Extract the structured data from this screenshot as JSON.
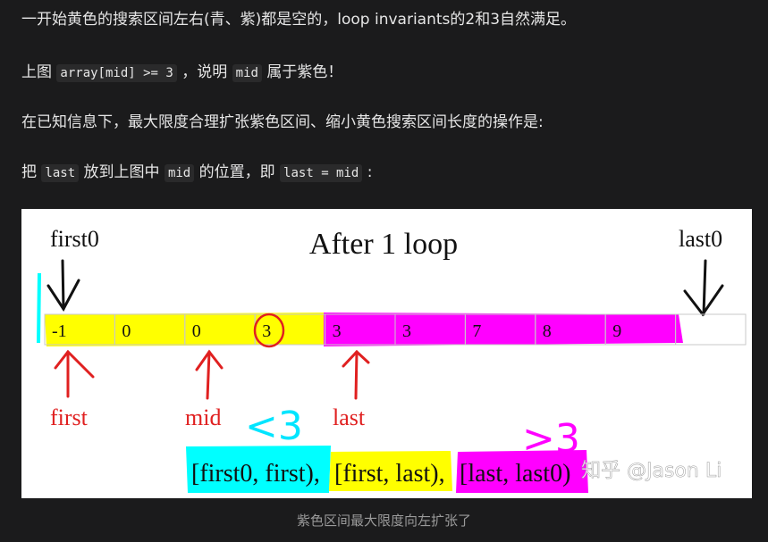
{
  "paragraphs": {
    "p1": "一开始黄色的搜索区间左右(青、紫)都是空的，loop invariants的2和3自然满足。",
    "p2_prefix": "上图",
    "p2_code1": "array[mid] >= 3",
    "p2_mid": "，说明",
    "p2_code2": "mid",
    "p2_suffix": "属于紫色！",
    "p3": "在已知信息下，最大限度合理扩张紫色区间、缩小黄色搜索区间长度的操作是:",
    "p4_prefix": "把",
    "p4_code1": "last",
    "p4_mid1": "放到上图中",
    "p4_code2": "mid",
    "p4_mid2": "的位置，即",
    "p4_code3": "last = mid",
    "p4_suffix": ":"
  },
  "figure": {
    "title": "After 1 loop",
    "label_first0": "first0",
    "label_last0": "last0",
    "cells": [
      "-1",
      "0",
      "0",
      "3",
      "3",
      "3",
      "7",
      "8",
      "9",
      ""
    ],
    "label_first": "first",
    "label_mid": "mid",
    "label_last": "last",
    "note_lt3": "<3",
    "note_ge3": ">3",
    "interval_cyan": "[first0, first),",
    "interval_yellow": "[first, last),",
    "interval_magenta": "[last, last0)",
    "watermark": "知乎 @Jason Li",
    "colors": {
      "yellow": "#ffff00",
      "magenta": "#ff00ff",
      "cyan": "#00ffff",
      "red": "#e02020"
    }
  },
  "caption": "紫色区间最大限度向左扩张了"
}
